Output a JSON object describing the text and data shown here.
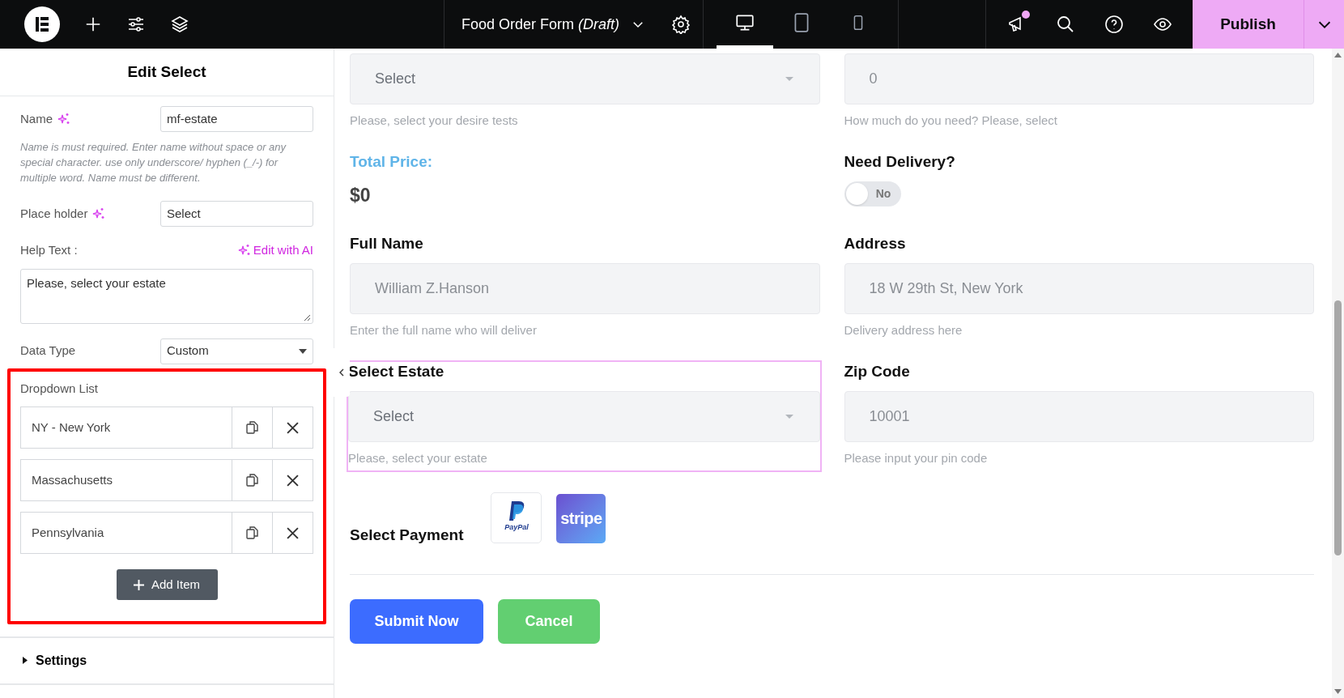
{
  "topbar": {
    "document_title": "Food Order Form *(Draft)*",
    "devices": [
      {
        "kind": "desktop",
        "selected": true
      },
      {
        "kind": "tablet",
        "selected": false
      },
      {
        "kind": "mobile",
        "selected": false
      }
    ],
    "notifications_unread": true,
    "publish_label": "Publish"
  },
  "panel": {
    "title": "Edit Select",
    "name": {
      "label": "Name",
      "value": "mf-estate",
      "help": "Name is must required. Enter name without space or any special character. use only underscore/ hyphen (_/-) for multiple word. Name must be different."
    },
    "placeholder": {
      "label": "Place holder",
      "value": "Select"
    },
    "help_text": {
      "label": "Help Text :",
      "ai_link": "Edit with AI",
      "value": "Please, select your estate"
    },
    "data_type": {
      "label": "Data Type",
      "value": "Custom"
    },
    "dropdown_list": {
      "label": "Dropdown List",
      "highlighted": true,
      "items": [
        {
          "label": "NY - New York"
        },
        {
          "label": "Massachusetts"
        },
        {
          "label": "Pennsylvania"
        }
      ],
      "add_label": "Add Item"
    },
    "sections": [
      {
        "label": "Settings",
        "expanded": false
      }
    ]
  },
  "form": {
    "fields": [
      {
        "kind": "select",
        "placeholder": "Select",
        "help": "Please, select your desire tests",
        "selected": false
      },
      {
        "kind": "input",
        "placeholder": "0",
        "help": "How much do you need? Please, select",
        "selected": false
      },
      {
        "kind": "price",
        "label": "Total Price:",
        "value": "$0",
        "selected": false
      },
      {
        "kind": "toggle",
        "label": "Need Delivery?",
        "on": false,
        "toggle_label": "No",
        "selected": false
      },
      {
        "kind": "input",
        "label": "Full Name",
        "placeholder": "William Z.Hanson",
        "help": "Enter the full name who will deliver",
        "selected": false
      },
      {
        "kind": "input",
        "label": "Address",
        "placeholder": "18 W 29th St, New York",
        "help": "Delivery address here",
        "selected": false
      },
      {
        "kind": "select",
        "label": "Select Estate",
        "placeholder": "Select",
        "help": "Please, select your estate",
        "selected": true
      },
      {
        "kind": "input",
        "label": "Zip Code",
        "placeholder": "10001",
        "help": "Please input your pin code",
        "selected": false
      }
    ],
    "payment": {
      "label": "Select Payment",
      "methods": [
        {
          "kind": "paypal",
          "text": "PayPal"
        },
        {
          "kind": "stripe",
          "text": "stripe"
        }
      ]
    },
    "buttons": [
      {
        "kind": "primary",
        "label": "Submit Now"
      },
      {
        "kind": "secondary",
        "label": "Cancel"
      }
    ]
  }
}
